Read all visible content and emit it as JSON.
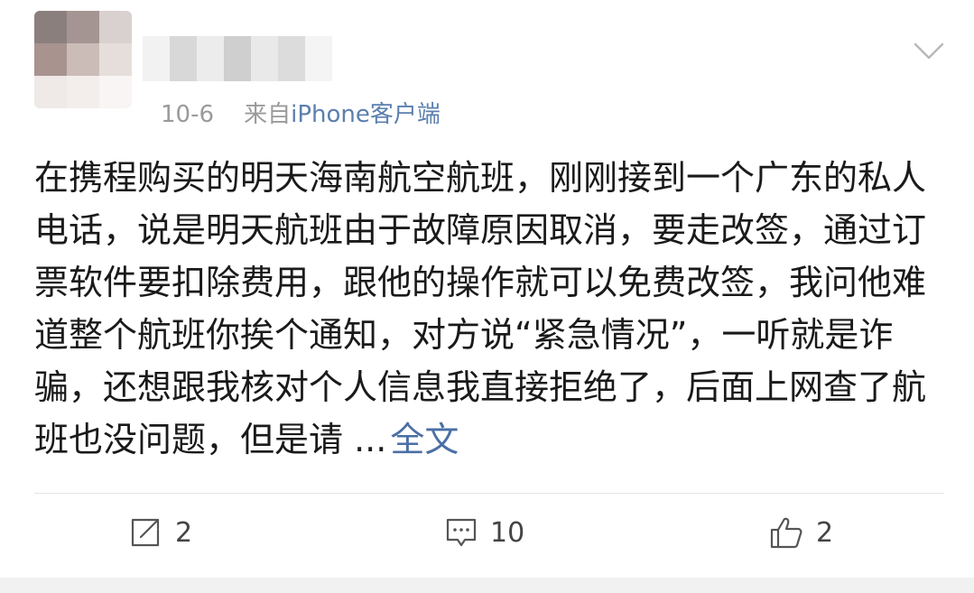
{
  "post": {
    "time": "10-6",
    "source_prefix": "来自",
    "source": "iPhone客户端",
    "text": "在携程购买的明天海南航空航班，刚刚接到一个广东的私人电话，说是明天航班由于故障原因取消，要走改签，通过订票软件要扣除费用，跟他的操作就可以免费改签，我问他难道整个航班你挨个通知，对方说“紧急情况”，一听就是诈骗，还想跟我核对个人信息我直接拒绝了，后面上网查了航班也没问题，但是请 ...",
    "more_label": "全文"
  },
  "actions": {
    "repost": {
      "icon": "share-icon",
      "count": "2"
    },
    "comment": {
      "icon": "comment-icon",
      "count": "10"
    },
    "like": {
      "icon": "thumbs-up-icon",
      "count": "2"
    }
  },
  "colors": {
    "link": "#4a6fa5",
    "meta": "#9a9a9a",
    "text": "#1a1a1a"
  }
}
